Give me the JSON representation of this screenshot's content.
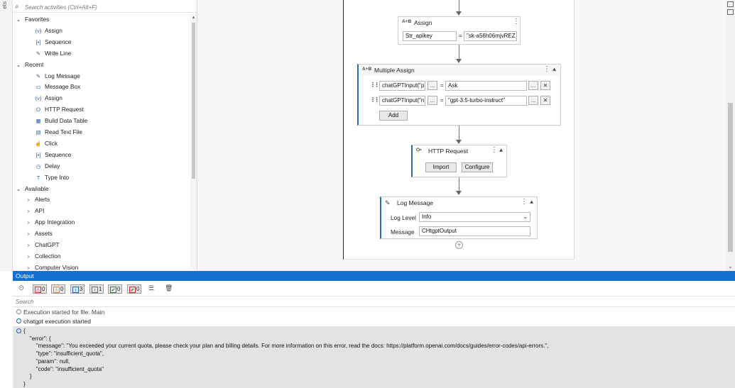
{
  "left_strip": {
    "label": "ets"
  },
  "activities": {
    "search_placeholder": "Search activities (Ctrl+Alt+F)",
    "sections": [
      {
        "label": "Favorites",
        "items": [
          {
            "label": "Assign",
            "icon": "assign-icon"
          },
          {
            "label": "Sequence",
            "icon": "sequence-icon"
          },
          {
            "label": "Write Line",
            "icon": "write-line-icon"
          }
        ]
      },
      {
        "label": "Recent",
        "items": [
          {
            "label": "Log Message",
            "icon": "log-message-icon"
          },
          {
            "label": "Message Box",
            "icon": "message-box-icon"
          },
          {
            "label": "Assign",
            "icon": "assign-icon"
          },
          {
            "label": "HTTP Request",
            "icon": "http-request-icon"
          },
          {
            "label": "Build Data Table",
            "icon": "build-data-table-icon"
          },
          {
            "label": "Read Text File",
            "icon": "read-text-file-icon"
          },
          {
            "label": "Click",
            "icon": "click-icon"
          },
          {
            "label": "Sequence",
            "icon": "sequence-icon"
          },
          {
            "label": "Delay",
            "icon": "delay-icon"
          },
          {
            "label": "Type Into",
            "icon": "type-into-icon"
          }
        ]
      },
      {
        "label": "Available",
        "items": [
          {
            "label": "Alerts"
          },
          {
            "label": "API"
          },
          {
            "label": "App Integration"
          },
          {
            "label": "Assets"
          },
          {
            "label": "ChatGPT"
          },
          {
            "label": "Collection"
          },
          {
            "label": "Computer Vision"
          }
        ]
      }
    ]
  },
  "designer": {
    "assign": {
      "title": "Assign",
      "badge": "A+B",
      "to": "Str_apikey",
      "value": "\"sk-a56h06mjvREZ"
    },
    "multiple_assign": {
      "title": "Multiple Assign",
      "badge": "A+B",
      "rows": [
        {
          "to": "chatGPTInput(\"p",
          "value": "Ask"
        },
        {
          "to": "chatGPTInput(\"n",
          "value": "\"gpt-3.5-turbo-instruct\""
        }
      ],
      "ellipsis": "...",
      "add_label": "Add"
    },
    "http_request": {
      "title": "HTTP Request",
      "import_label": "Import",
      "configure_label": "Configure"
    },
    "log_message": {
      "title": "Log Message",
      "level_label": "Log Level",
      "level_value": "Info",
      "message_label": "Message",
      "message_value": "CHtgptOutput"
    },
    "eq": "="
  },
  "output": {
    "title": "Output",
    "filters": [
      {
        "icon": "error-icon",
        "count": "0",
        "color": "#d32f2f"
      },
      {
        "icon": "warning-icon",
        "count": "0",
        "color": "#e09b00"
      },
      {
        "icon": "info-icon",
        "count": "3",
        "color": "#1565c0"
      },
      {
        "icon": "trace-icon",
        "count": "1",
        "color": "#666666"
      },
      {
        "icon": "success-icon",
        "count": "0",
        "color": "#2e7d32"
      },
      {
        "icon": "failed-icon",
        "count": "0",
        "color": "#c62828"
      }
    ],
    "search_placeholder": "Search",
    "lines": [
      "Execution started for file: Main",
      "chatgpt execution started"
    ],
    "json_lines": [
      "{",
      "    \"error\": {",
      "        \"message\": \"You exceeded your current quota, please check your plan and billing details. For more information on this error, read the docs: https://platform.openai.com/docs/guides/error-codes/api-errors.\",",
      "        \"type\": \"insufficient_quota\",",
      "        \"param\": null,",
      "        \"code\": \"insufficient_quota\"",
      "    }",
      "}"
    ]
  }
}
